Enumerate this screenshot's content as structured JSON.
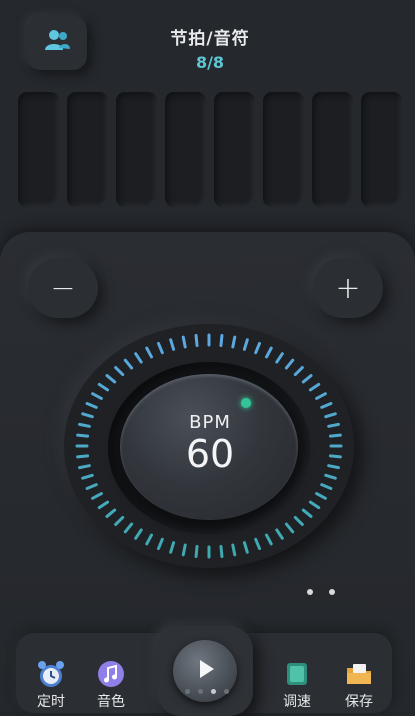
{
  "header": {
    "title": "节拍/音符",
    "count": "8/8"
  },
  "beats": {
    "count": 8
  },
  "controls": {
    "minus_symbol": "−",
    "plus_symbol": "+"
  },
  "dial": {
    "label": "BPM",
    "value": "60"
  },
  "toolbar": {
    "timer_label": "定时",
    "sound_label": "音色",
    "tempo_label": "调速",
    "save_label": "保存"
  },
  "colors": {
    "accent": "#5ec6d3",
    "led": "#35c49a",
    "background": "#25282d"
  },
  "icons": {
    "top_button": "users-icon",
    "play": "play-icon",
    "timer": "alarm-clock-icon",
    "sound": "music-note-icon",
    "tempo": "tempo-icon",
    "save": "folder-icon"
  }
}
